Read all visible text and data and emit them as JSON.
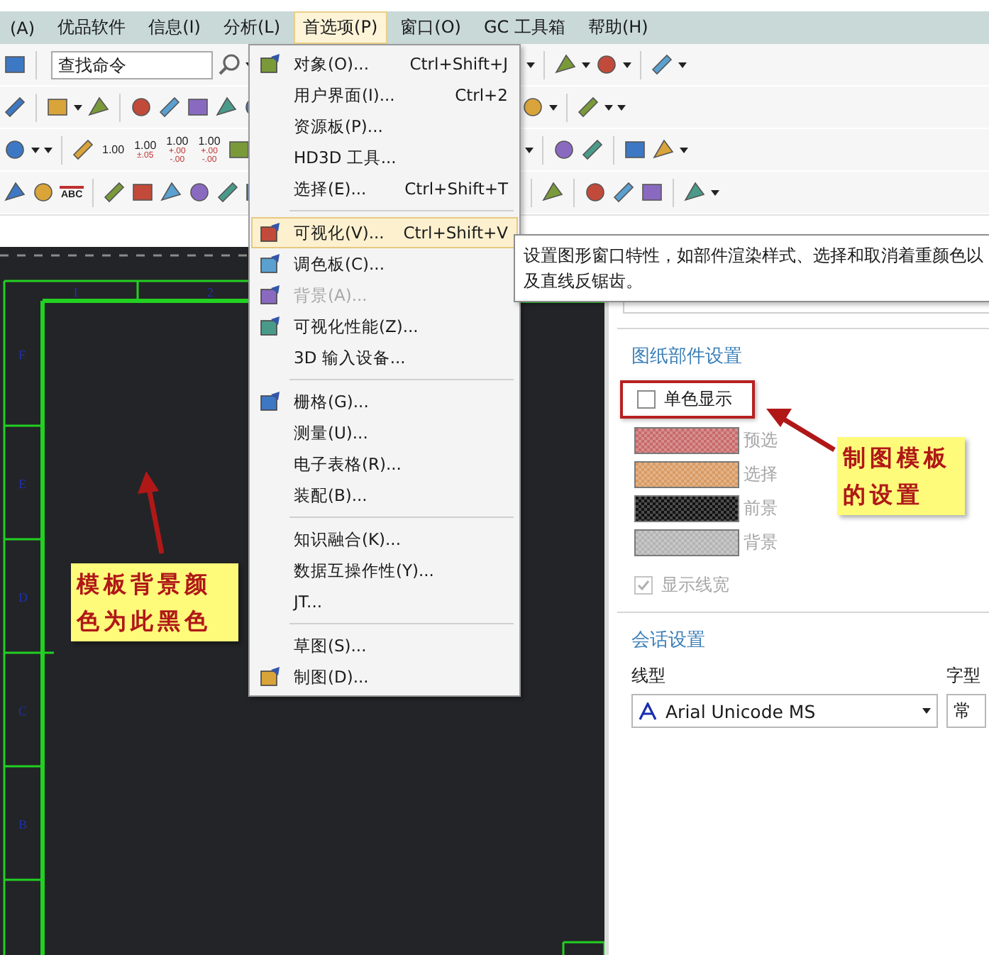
{
  "menu_bar": {
    "items": [
      {
        "label": "(A)",
        "selected": false
      },
      {
        "label": "优品软件",
        "selected": false
      },
      {
        "label": "信息(I)",
        "selected": false
      },
      {
        "label": "分析(L)",
        "selected": false
      },
      {
        "label": "首选项(P)",
        "selected": true
      },
      {
        "label": "窗口(O)",
        "selected": false
      },
      {
        "label": "GC 工具箱",
        "selected": false
      },
      {
        "label": "帮助(H)",
        "selected": false
      }
    ]
  },
  "toolbar": {
    "search": {
      "placeholder": "查找命令"
    },
    "dimension_buttons": [
      {
        "value": "1.00"
      },
      {
        "value": "1.00",
        "upper": "±.05"
      },
      {
        "value": "1.00",
        "upper": "+.00",
        "lower": "-.00"
      },
      {
        "value": "1.00",
        "upper": "+.00",
        "lower": "-.00"
      }
    ],
    "text_button": "ABC"
  },
  "dropdown_menu": {
    "items": [
      {
        "kind": "icon",
        "label": "对象(O)...",
        "shortcut": "Ctrl+Shift+J",
        "selected": false,
        "disabled": false
      },
      {
        "kind": "text",
        "label": "用户界面(I)...",
        "shortcut": "Ctrl+2",
        "selected": false,
        "disabled": false
      },
      {
        "kind": "text",
        "label": "资源板(P)...",
        "selected": false,
        "disabled": false
      },
      {
        "kind": "text",
        "label": "HD3D 工具...",
        "selected": false,
        "disabled": false
      },
      {
        "kind": "text",
        "label": "选择(E)...",
        "shortcut": "Ctrl+Shift+T",
        "selected": false,
        "disabled": false
      },
      {
        "kind": "separator"
      },
      {
        "kind": "icon",
        "label": "可视化(V)...",
        "shortcut": "Ctrl+Shift+V",
        "selected": true,
        "disabled": false
      },
      {
        "kind": "icon",
        "label": "调色板(C)...",
        "selected": false,
        "disabled": false
      },
      {
        "kind": "icon",
        "label": "背景(A)...",
        "selected": false,
        "disabled": true
      },
      {
        "kind": "icon",
        "label": "可视化性能(Z)...",
        "selected": false,
        "disabled": false
      },
      {
        "kind": "text",
        "label": "3D 输入设备...",
        "selected": false,
        "disabled": false
      },
      {
        "kind": "separator"
      },
      {
        "kind": "icon",
        "label": "栅格(G)...",
        "selected": false,
        "disabled": false
      },
      {
        "kind": "text",
        "label": "测量(U)...",
        "selected": false,
        "disabled": false
      },
      {
        "kind": "text",
        "label": "电子表格(R)...",
        "selected": false,
        "disabled": false
      },
      {
        "kind": "text",
        "label": "装配(B)...",
        "selected": false,
        "disabled": false
      },
      {
        "kind": "separator"
      },
      {
        "kind": "text",
        "label": "知识融合(K)...",
        "selected": false,
        "disabled": false
      },
      {
        "kind": "text",
        "label": "数据互操作性(Y)...",
        "selected": false,
        "disabled": false
      },
      {
        "kind": "text",
        "label": "JT...",
        "selected": false,
        "disabled": false
      },
      {
        "kind": "separator"
      },
      {
        "kind": "text",
        "label": "草图(S)...",
        "selected": false,
        "disabled": false
      },
      {
        "kind": "icon",
        "label": "制图(D)...",
        "selected": false,
        "disabled": false
      }
    ]
  },
  "tooltip": {
    "text": "设置图形窗口特性，如部件渲染样式、选择和取消着重颜色以及直线反锯齿。"
  },
  "canvas": {
    "column_zones": [
      "1",
      "2"
    ],
    "row_zones": [
      "F",
      "E",
      "D",
      "C",
      "B"
    ]
  },
  "annotations": [
    {
      "text": "模板背景颜色为此黑色"
    },
    {
      "text": "制图模板的设置"
    }
  ],
  "panel": {
    "drawing_section": {
      "title": "图纸部件设置",
      "monochrome": {
        "label": "单色显示",
        "checked": false
      },
      "colors": [
        {
          "label": "预选",
          "color": "#c86a6a",
          "disabled": true
        },
        {
          "label": "选择",
          "color": "#d99a62",
          "disabled": true
        },
        {
          "label": "前景",
          "color": "#111111",
          "disabled": true
        },
        {
          "label": "背景",
          "color": "#b4b4b4",
          "disabled": true
        }
      ],
      "line_width": {
        "label": "显示线宽",
        "checked": true,
        "disabled": true
      }
    },
    "session_section": {
      "title": "会话设置",
      "line_font": {
        "label": "线型",
        "value": "Arial Unicode MS"
      },
      "char_font": {
        "label": "字型",
        "value": "常"
      }
    }
  }
}
